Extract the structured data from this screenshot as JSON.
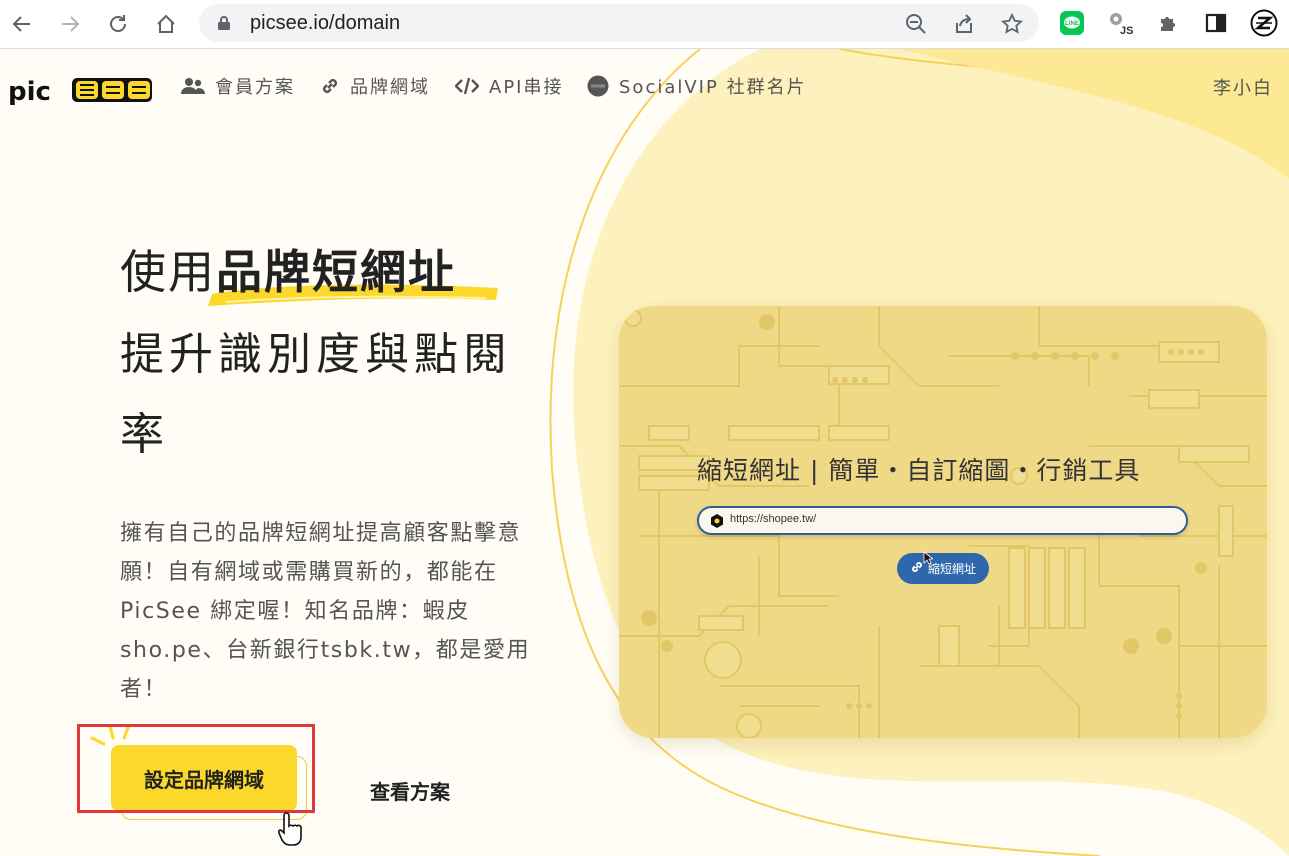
{
  "browser": {
    "url": "picsee.io/domain"
  },
  "nav": {
    "logo_text": "PicSee",
    "items": [
      {
        "label": "會員方案",
        "icon": "users-icon"
      },
      {
        "label": "品牌網域",
        "icon": "link-icon"
      },
      {
        "label": "API串接",
        "icon": "code-icon"
      },
      {
        "label": "SocialVIP 社群名片",
        "icon": "socialvip-icon"
      }
    ],
    "user": "李小白"
  },
  "hero": {
    "title_prefix": "使用",
    "title_bold": "品牌短網址",
    "title_line2": "提升識別度與點閱",
    "title_line3": "率",
    "description": "擁有自己的品牌短網址提高顧客點擊意願！自有網域或需購買新的，都能在 PicSee 綁定喔！知名品牌：蝦皮 sho.pe、台新銀行tsbk.tw，都是愛用者！",
    "cta_label": "設定品牌網域",
    "secondary_label": "查看方案"
  },
  "promo": {
    "title": "縮短網址 | 簡單・自訂縮圖・行銷工具",
    "input_value": "https://shopee.tw/",
    "button_label": "縮短網址"
  },
  "colors": {
    "brand_yellow": "#fbd82a",
    "highlight_border": "#e0383b",
    "button_blue": "#2f67ad"
  }
}
